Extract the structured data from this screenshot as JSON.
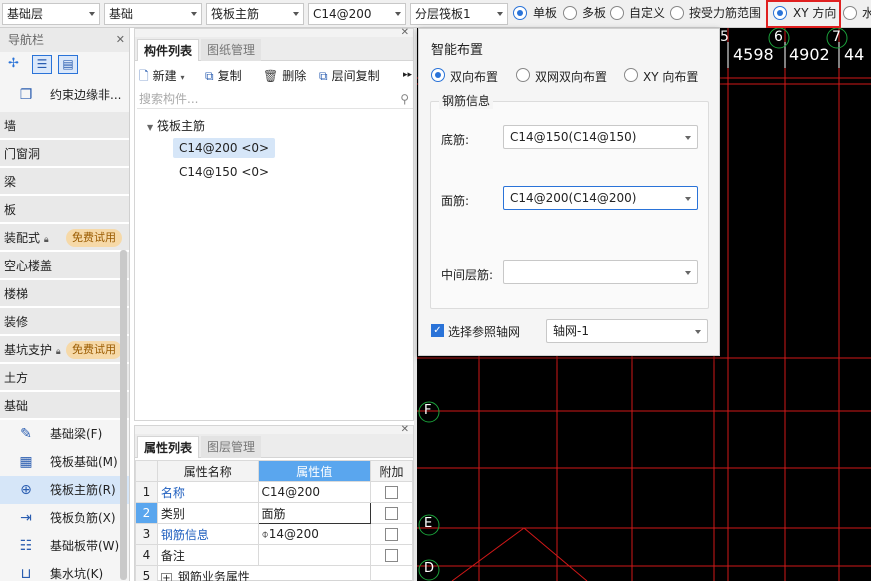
{
  "toolbar": {
    "layer": "基础层",
    "category": "基础",
    "component_type": "筏板主筋",
    "component": "C14@200",
    "sublayer": "分层筏板1",
    "radios": [
      "单板",
      "多板",
      "自定义",
      "按受力筋范围",
      "XY 方向",
      "水"
    ],
    "selected_radio": "单板"
  },
  "nav": {
    "title": "导航栏",
    "items": [
      {
        "label": "约束边缘非..."
      },
      {
        "label": "墙"
      },
      {
        "label": "门窗洞"
      },
      {
        "label": "梁"
      },
      {
        "label": "板"
      },
      {
        "label": "装配式",
        "badge": "免费试用"
      },
      {
        "label": "空心楼盖"
      },
      {
        "label": "楼梯"
      },
      {
        "label": "装修"
      },
      {
        "label": "基坑支护",
        "badge": "免费试用"
      },
      {
        "label": "土方"
      },
      {
        "label": "基础"
      },
      {
        "label": "基础梁(F)"
      },
      {
        "label": "筏板基础(M)"
      },
      {
        "label": "筏板主筋(R)"
      },
      {
        "label": "筏板负筋(X)"
      },
      {
        "label": "基础板带(W)"
      },
      {
        "label": "集水坑(K)"
      }
    ]
  },
  "component_list": {
    "tabs": [
      "构件列表",
      "图纸管理"
    ],
    "actions": [
      "新建",
      "复制",
      "删除",
      "层间复制"
    ],
    "search_placeholder": "搜索构件...",
    "tree_root": "筏板主筋",
    "items": [
      "C14@200 <0>",
      "C14@150 <0>"
    ]
  },
  "properties": {
    "tabs": [
      "属性列表",
      "图层管理"
    ],
    "headers": [
      "属性名称",
      "属性值",
      "附加"
    ],
    "rows": [
      {
        "no": "1",
        "name": "名称",
        "value": "C14@200"
      },
      {
        "no": "2",
        "name": "类别",
        "value": "面筋"
      },
      {
        "no": "3",
        "name": "钢筋信息",
        "value": "14@200"
      },
      {
        "no": "4",
        "name": "备注",
        "value": ""
      },
      {
        "no": "5",
        "name": "钢筋业务属性",
        "value": ""
      }
    ]
  },
  "dialog": {
    "title": "智能布置",
    "options": [
      "双向布置",
      "双网双向布置",
      "XY 向布置"
    ],
    "selected": "双向布置",
    "group_title": "钢筋信息",
    "bottom_label": "底筋:",
    "bottom_value": "C14@150(C14@150)",
    "top_label": "面筋:",
    "top_value": "C14@200(C14@200)",
    "middle_label": "中间层筋:",
    "middle_value": "",
    "axis_check_label": "选择参照轴网",
    "axis_value": "轴网-1"
  },
  "canvas": {
    "col_labels": [
      "5",
      "6",
      "7"
    ],
    "dims": [
      "4598",
      "4902",
      "44"
    ],
    "row_labels": [
      "F",
      "E",
      "D"
    ]
  },
  "colors": {
    "accent": "#2a73d8",
    "highlight": "#e02020",
    "grid": "#d01818",
    "axis": "#1aa13a"
  }
}
